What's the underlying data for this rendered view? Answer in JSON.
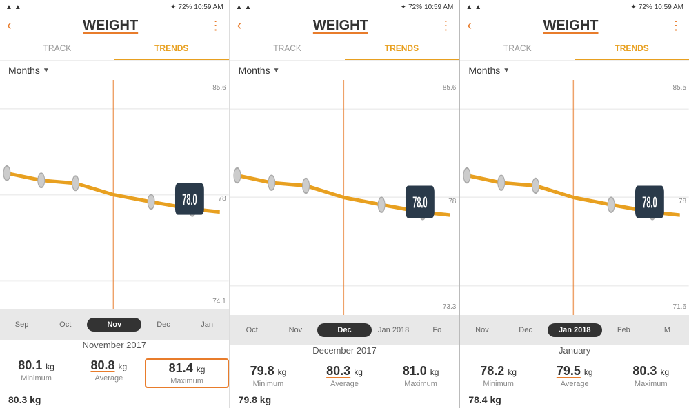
{
  "panels": [
    {
      "id": "panel1",
      "statusBar": {
        "left": "▲  ▲",
        "time": "10:59 AM",
        "battery": "72%"
      },
      "header": {
        "back": "‹",
        "title": "WEIGHT",
        "menu": "⋮"
      },
      "tabs": [
        "TRACK",
        "TRENDS"
      ],
      "activeTab": "TRENDS",
      "period": "Months",
      "chart": {
        "yMax": 85.6,
        "yMid": 78.0,
        "yMin": 74.1,
        "selectedValue": "78.0"
      },
      "timeline": [
        "Sep",
        "Oct",
        "Nov",
        "Dec",
        "Jan"
      ],
      "selectedMonth": "Nov",
      "selectedMonthIndex": 2,
      "periodLabel": "November 2017",
      "stats": [
        {
          "value": "80.1",
          "unit": "kg",
          "label": "Minimum",
          "underline": false,
          "highlighted": false
        },
        {
          "value": "80.8",
          "unit": "kg",
          "label": "Average",
          "underline": true,
          "highlighted": false
        },
        {
          "value": "81.4",
          "unit": "kg",
          "label": "Maximum",
          "underline": false,
          "highlighted": true
        }
      ],
      "bottomValue": "80.3 kg"
    },
    {
      "id": "panel2",
      "statusBar": {
        "left": "▲  ▲",
        "time": "10:59 AM",
        "battery": "72%"
      },
      "header": {
        "back": "‹",
        "title": "WEIGHT",
        "menu": "⋮"
      },
      "tabs": [
        "TRACK",
        "TRENDS"
      ],
      "activeTab": "TRENDS",
      "period": "Months",
      "chart": {
        "yMax": 85.6,
        "yMid": 78.0,
        "yMin": 73.3,
        "selectedValue": "78.0"
      },
      "timeline": [
        "Oct",
        "Nov",
        "Dec",
        "Jan 2018",
        "Fo"
      ],
      "selectedMonth": "Dec",
      "selectedMonthIndex": 2,
      "periodLabel": "December 2017",
      "stats": [
        {
          "value": "79.8",
          "unit": "kg",
          "label": "Minimum",
          "underline": false,
          "highlighted": false
        },
        {
          "value": "80.3",
          "unit": "kg",
          "label": "Average",
          "underline": true,
          "highlighted": false
        },
        {
          "value": "81.0",
          "unit": "kg",
          "label": "Maximum",
          "underline": false,
          "highlighted": false
        }
      ],
      "bottomValue": "79.8 kg"
    },
    {
      "id": "panel3",
      "statusBar": {
        "left": "▲  ▲",
        "time": "10:59 AM",
        "battery": "72%"
      },
      "header": {
        "back": "‹",
        "title": "WEIGHT",
        "menu": "⋮"
      },
      "tabs": [
        "TRACK",
        "TRENDS"
      ],
      "activeTab": "TRENDS",
      "period": "Months",
      "chart": {
        "yMax": 85.5,
        "yMid": 78.0,
        "yMin": 71.6,
        "selectedValue": "78.0"
      },
      "timeline": [
        "Nov",
        "Dec",
        "Jan 2018",
        "Feb",
        "M"
      ],
      "selectedMonth": "Jan 2018",
      "selectedMonthIndex": 2,
      "periodLabel": "January",
      "stats": [
        {
          "value": "78.2",
          "unit": "kg",
          "label": "Minimum",
          "underline": false,
          "highlighted": false
        },
        {
          "value": "79.5",
          "unit": "kg",
          "label": "Average",
          "underline": true,
          "highlighted": false
        },
        {
          "value": "80.3",
          "unit": "kg",
          "label": "Maximum",
          "underline": false,
          "highlighted": false
        }
      ],
      "bottomValue": "78.4 kg"
    }
  ]
}
